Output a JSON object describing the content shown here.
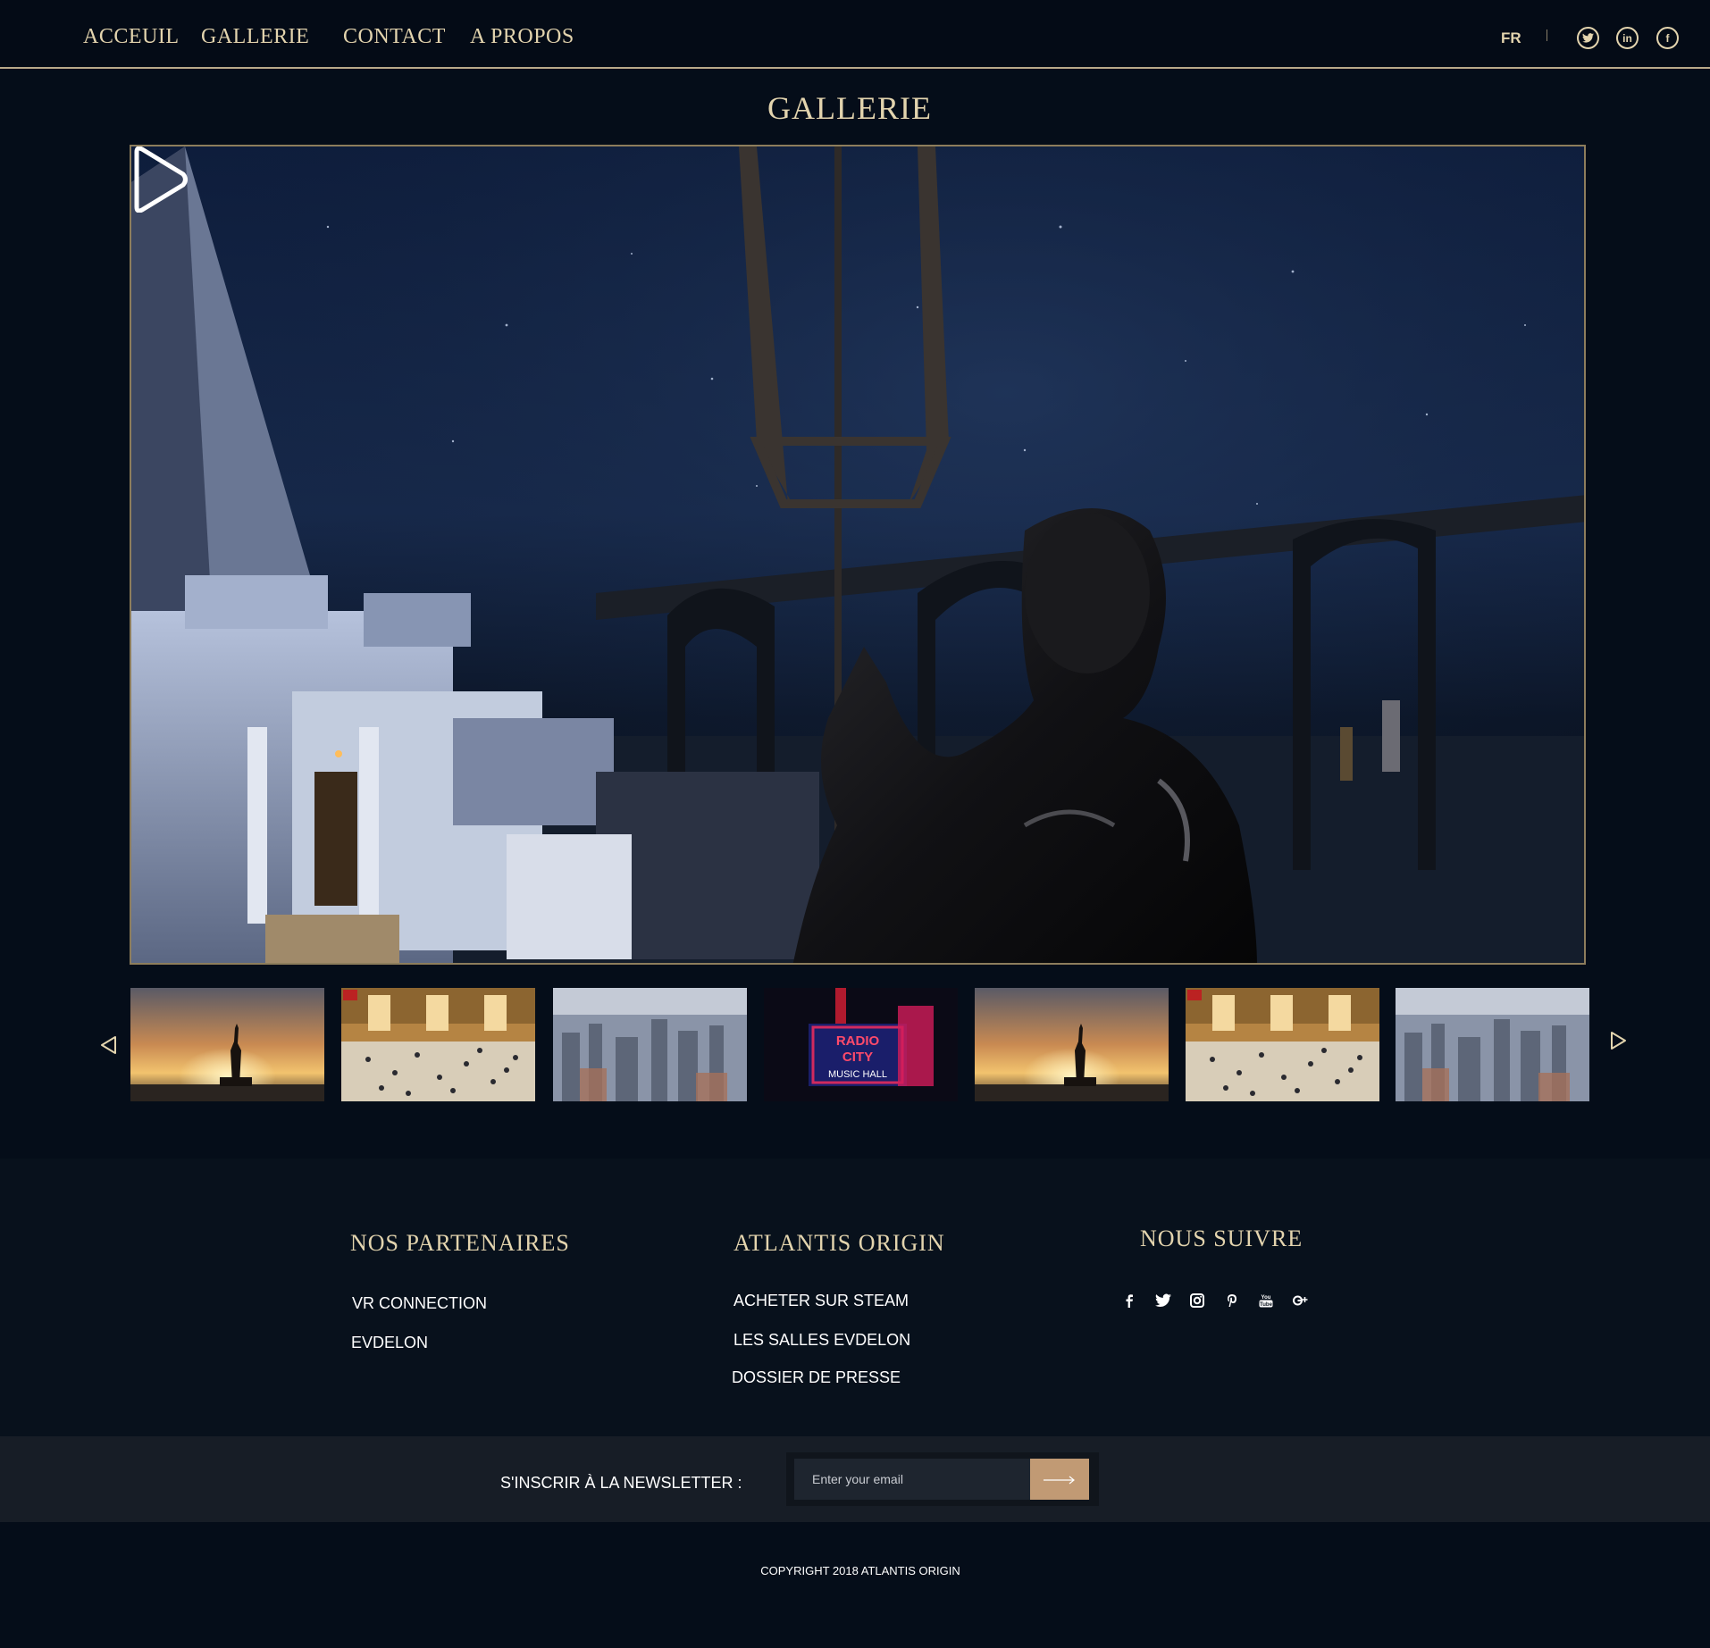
{
  "nav": {
    "items": [
      "ACCEUIL",
      "GALLERIE",
      "CONTACT",
      "A PROPOS"
    ],
    "language": "FR",
    "social_icons": [
      "twitter-icon",
      "linkedin-icon",
      "facebook-icon"
    ]
  },
  "page": {
    "title": "GALLERIE"
  },
  "gallery": {
    "video_poster": "night-atlantis-trident-statue",
    "play_icon": "play-icon",
    "thumbnails": [
      {
        "subject": "statue-of-liberty-sunset"
      },
      {
        "subject": "grand-central-terminal"
      },
      {
        "subject": "new-york-aerial"
      },
      {
        "subject": "radio-city-music-hall"
      },
      {
        "subject": "statue-of-liberty-sunset"
      },
      {
        "subject": "grand-central-terminal"
      },
      {
        "subject": "new-york-aerial"
      }
    ],
    "radio_city_text": [
      "RADIO",
      "CITY",
      "MUSIC HALL"
    ],
    "prev_icon": "triangle-left-icon",
    "next_icon": "triangle-right-icon"
  },
  "footer": {
    "partners": {
      "heading": "NOS PARTENAIRES",
      "links": [
        "VR CONNECTION",
        "EVDELON"
      ]
    },
    "atlantis": {
      "heading": "ATLANTIS ORIGIN",
      "links": [
        "ACHETER SUR STEAM",
        "LES SALLES EVDELON",
        "DOSSIER DE PRESSE"
      ]
    },
    "follow": {
      "heading": "NOUS SUIVRE",
      "icons": [
        "facebook-icon",
        "twitter-icon",
        "instagram-icon",
        "pinterest-icon",
        "youtube-icon",
        "google-plus-icon"
      ]
    }
  },
  "newsletter": {
    "label": "S'INSCRIR À LA NEWSLETTER :",
    "placeholder": "Enter your email",
    "button_icon": "long-arrow-right-icon"
  },
  "copyright": "COPYRIGHT 2018 ATLANTIS ORIGIN",
  "colors": {
    "background": "#050d19",
    "gold": "#e3d4ae",
    "footer": "#08111c",
    "newsletter_bar": "#171d26",
    "button": "#c19a74"
  }
}
